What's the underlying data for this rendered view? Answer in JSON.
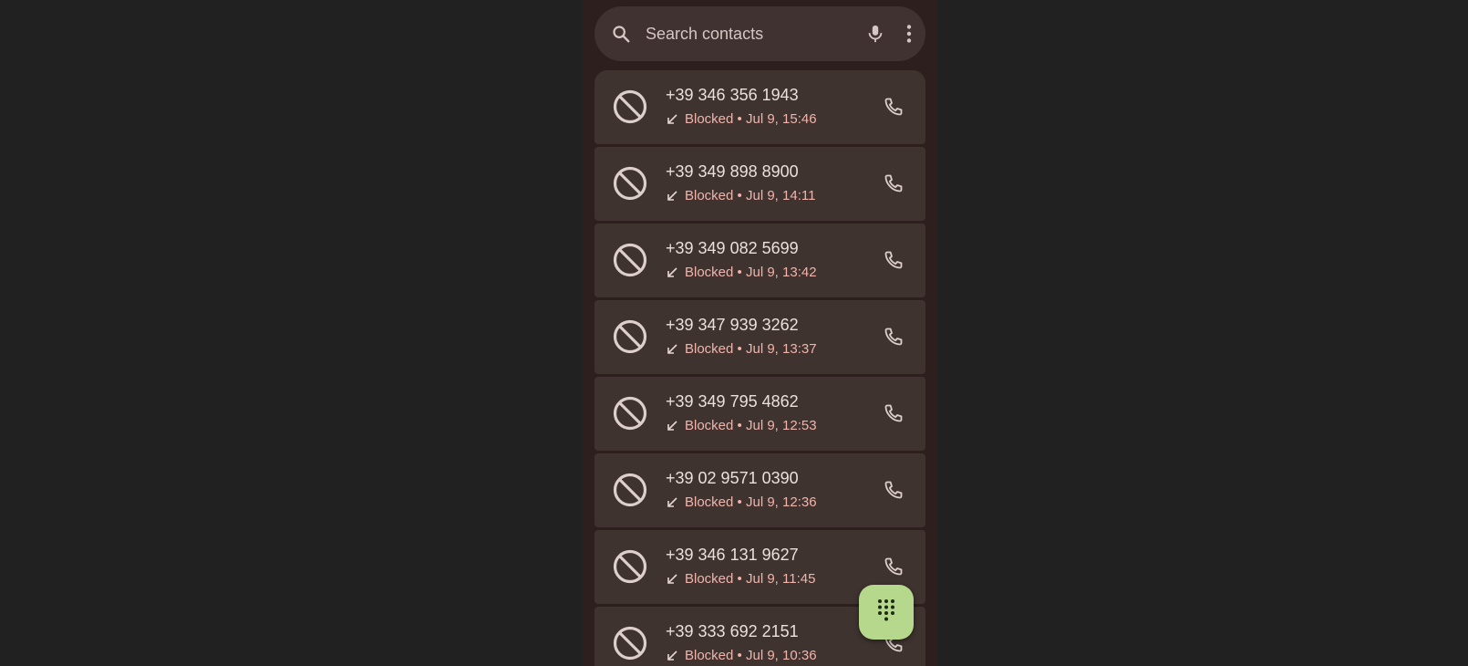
{
  "search": {
    "placeholder": "Search contacts",
    "icon": "search-icon",
    "mic_icon": "mic-icon",
    "menu_icon": "more-vert-icon"
  },
  "calls": [
    {
      "number": "+39 346 356 1943",
      "status": "Blocked",
      "separator": "•",
      "time": "Jul 9, 15:46"
    },
    {
      "number": "+39 349 898 8900",
      "status": "Blocked",
      "separator": "•",
      "time": "Jul 9, 14:11"
    },
    {
      "number": "+39 349 082 5699",
      "status": "Blocked",
      "separator": "•",
      "time": "Jul 9, 13:42"
    },
    {
      "number": "+39 347 939 3262",
      "status": "Blocked",
      "separator": "•",
      "time": "Jul 9, 13:37"
    },
    {
      "number": "+39 349 795 4862",
      "status": "Blocked",
      "separator": "•",
      "time": "Jul 9, 12:53"
    },
    {
      "number": "+39 02 9571 0390",
      "status": "Blocked",
      "separator": "•",
      "time": "Jul 9, 12:36"
    },
    {
      "number": "+39 346 131 9627",
      "status": "Blocked",
      "separator": "•",
      "time": "Jul 9, 11:45"
    },
    {
      "number": "+39 333 692 2151",
      "status": "Blocked",
      "separator": "•",
      "time": "Jul 9, 10:36"
    }
  ],
  "fab": {
    "icon": "dialpad-icon"
  },
  "colors": {
    "background": "#212121",
    "app_background": "#2c1f1d",
    "row_background": "#3f3330",
    "blocked_text": "#f2b3aa",
    "fab": "#b5d88c"
  }
}
